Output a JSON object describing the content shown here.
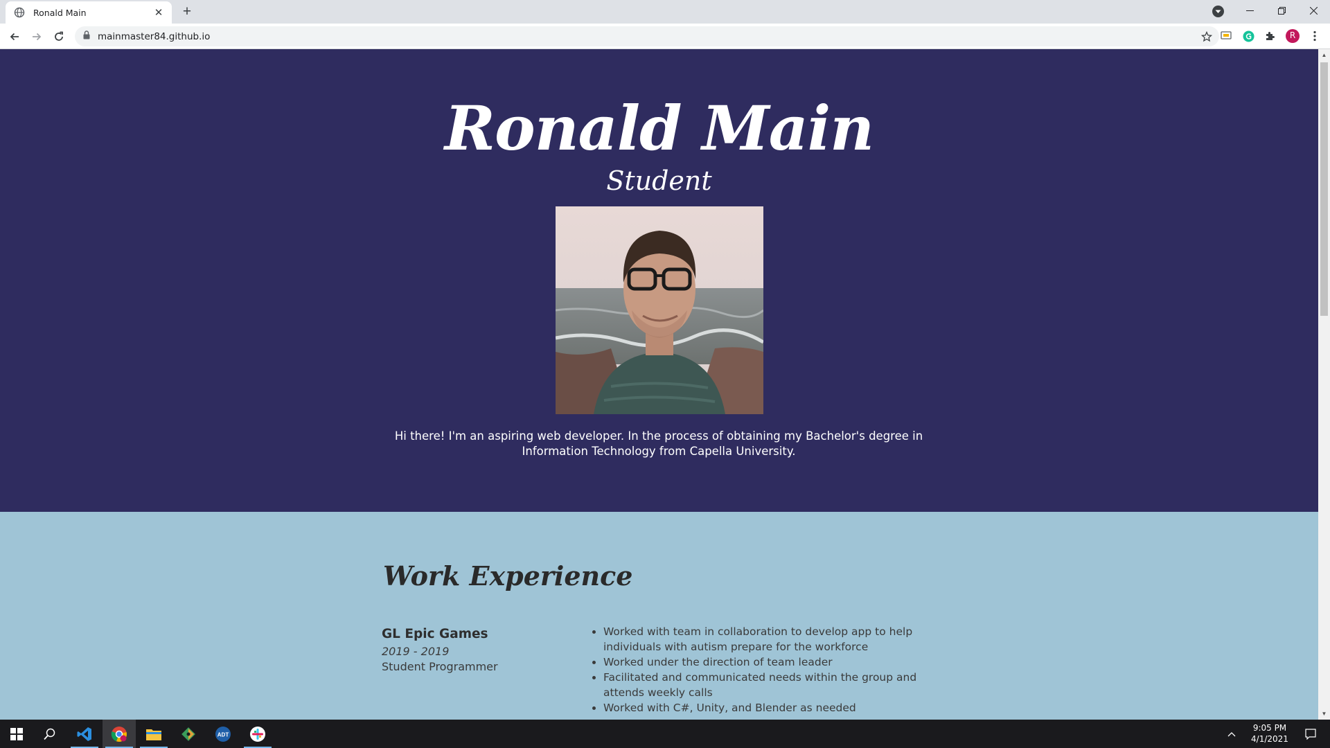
{
  "browser": {
    "tab_title": "Ronald Main",
    "tab_close": "✕",
    "new_tab": "+",
    "url": "mainmaster84.github.io",
    "profile_initial": "R"
  },
  "hero": {
    "name": "Ronald Main",
    "role": "Student",
    "bio": "Hi there! I'm an aspiring web developer. In the process of obtaining my Bachelor's degree in Information Technology from Capella University."
  },
  "work": {
    "title": "Work Experience",
    "jobs": [
      {
        "company": "GL Epic Games",
        "dates": "2019 - 2019",
        "role": "Student Programmer",
        "duties": [
          "Worked with team in collaboration to develop app to help individuals with autism prepare for the workforce",
          "Worked under the direction of team leader",
          "Facilitated and communicated needs within the group and attends weekly calls",
          "Worked with C#, Unity, and Blender as needed"
        ]
      }
    ]
  },
  "taskbar": {
    "time": "9:05 PM",
    "date": "4/1/2021",
    "apps": [
      "windows-start",
      "search",
      "vs-code",
      "chrome",
      "file-explorer",
      "git",
      "adt",
      "slack"
    ]
  },
  "colors": {
    "hero_bg": "#2f2c5f",
    "work_bg": "#9fc4d6",
    "taskbar_bg": "#1a1a1d",
    "profile_avatar": "#c2185b"
  }
}
